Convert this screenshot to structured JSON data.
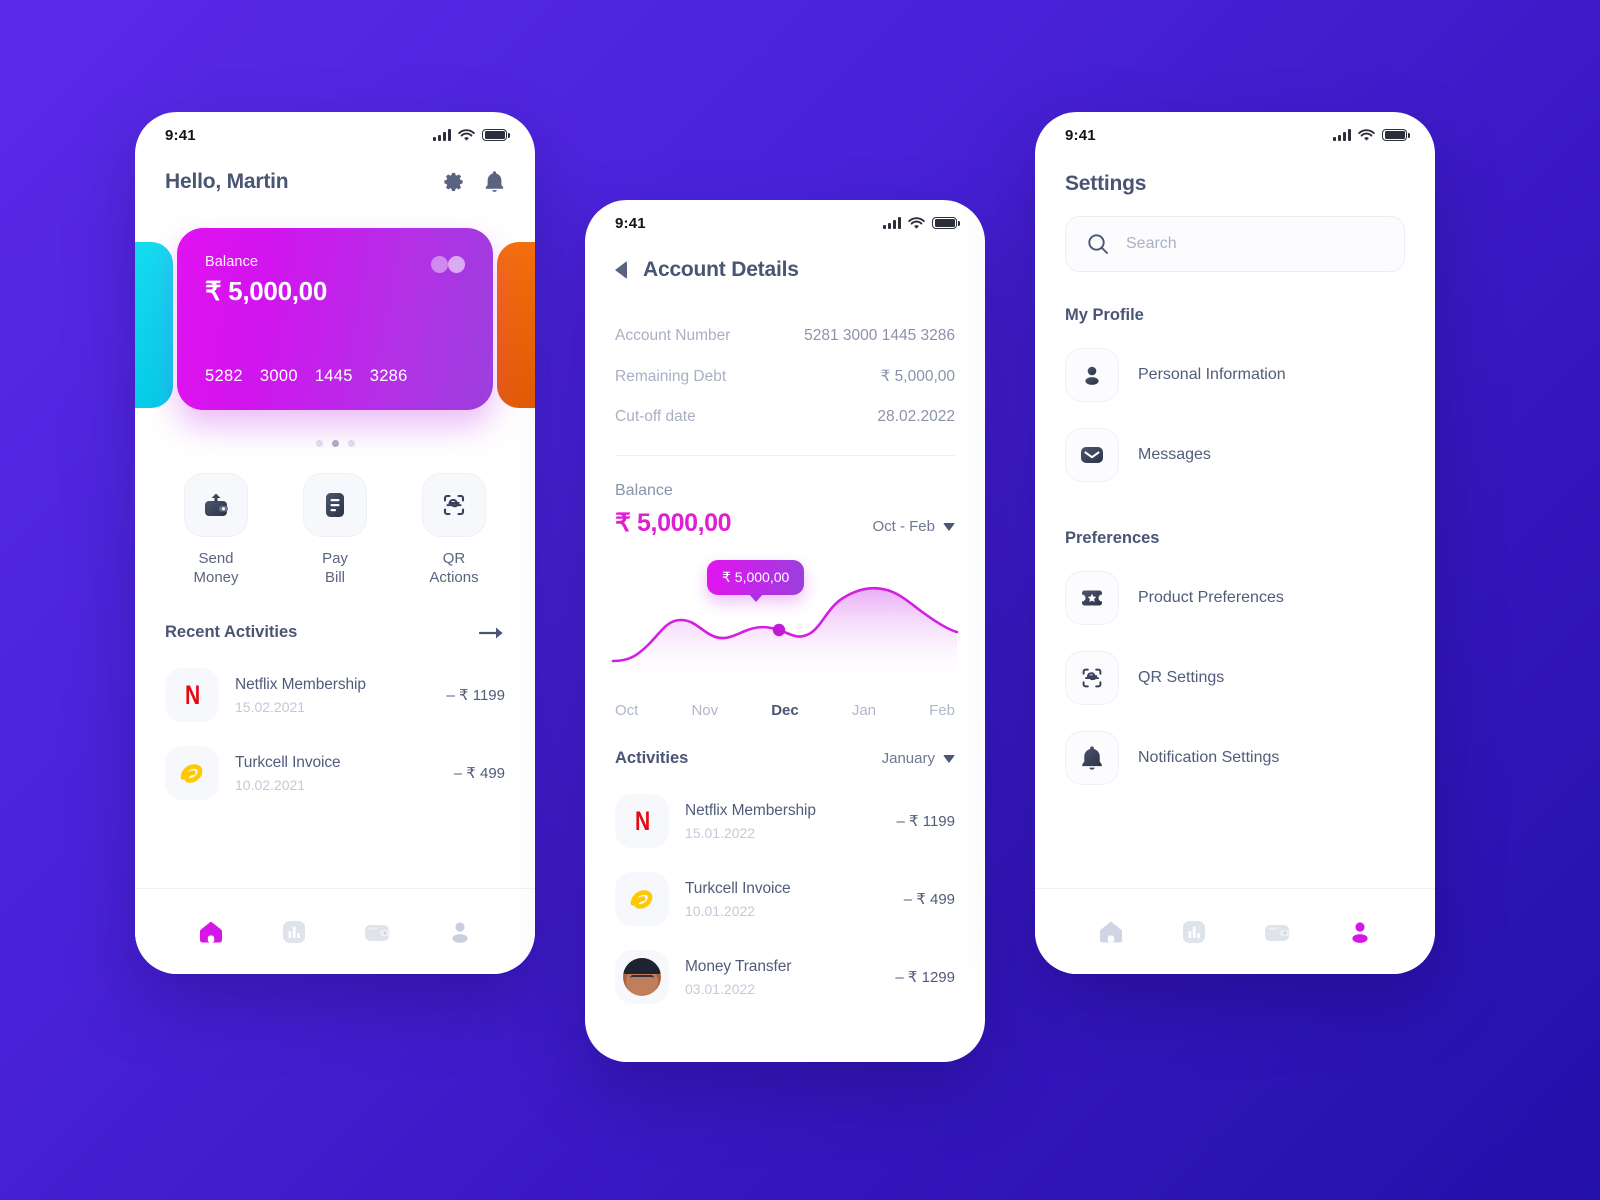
{
  "theme": {
    "bg_gradient_from": "#5a2ae8",
    "bg_gradient_to": "#2410aa",
    "accent_magenta": "#e020d0",
    "card_gradient_from": "#e112f0",
    "card_gradient_to": "#9b3fdd",
    "side_card_cyan": "#16dcf0",
    "side_card_orange": "#f5700f",
    "text_slate": "#4a5573"
  },
  "status_bar": {
    "time": "9:41"
  },
  "home": {
    "greeting": "Hello, Martin",
    "icons": {
      "settings": "gear-icon",
      "notifications": "bell-icon"
    },
    "card": {
      "label": "Balance",
      "amount": "₹ 5,000,00",
      "number_groups": [
        "5282",
        "3000",
        "1445",
        "3286"
      ]
    },
    "carousel": {
      "dots": 3,
      "active_index": 1
    },
    "quick_actions": [
      {
        "label": "Send\nMoney",
        "line1": "Send",
        "line2": "Money",
        "icon": "wallet-upload-icon"
      },
      {
        "label": "Pay Bill",
        "line1": "Pay",
        "line2": "Bill",
        "icon": "document-icon"
      },
      {
        "label": "QR Actions",
        "line1": "QR",
        "line2": "Actions",
        "icon": "qr-scan-icon"
      }
    ],
    "recent": {
      "title": "Recent Activities",
      "see_all_icon": "arrow-right-icon",
      "items": [
        {
          "name": "Netflix Membership",
          "date": "15.02.2021",
          "amount": "– ₹ 1199",
          "icon": "netflix-logo"
        },
        {
          "name": "Turkcell Invoice",
          "date": "10.02.2021",
          "amount": "– ₹ 499",
          "icon": "turkcell-logo"
        }
      ]
    },
    "nav": {
      "active": "home",
      "items": [
        "home-icon",
        "chart-icon",
        "wallet-icon",
        "person-icon"
      ]
    }
  },
  "account": {
    "title": "Account Details",
    "back_icon": "back-arrow-icon",
    "details": [
      {
        "key": "Account Number",
        "value": "5281 3000  1445 3286"
      },
      {
        "key": "Remaining Debt",
        "value": "₹ 5,000,00"
      },
      {
        "key": "Cut-off date",
        "value": "28.02.2022"
      }
    ],
    "balance": {
      "label": "Balance",
      "amount": "₹ 5,000,00",
      "range": "Oct - Feb",
      "tooltip": "₹ 5,000,00"
    },
    "activities": {
      "title": "Activities",
      "month_filter": "January",
      "items": [
        {
          "name": "Netflix Membership",
          "date": "15.01.2022",
          "amount": "– ₹ 1199",
          "icon": "netflix-logo"
        },
        {
          "name": "Turkcell Invoice",
          "date": "10.01.2022",
          "amount": "– ₹ 499",
          "icon": "turkcell-logo"
        },
        {
          "name": "Money Transfer",
          "date": "03.01.2022",
          "amount": "– ₹ 1299",
          "icon": "avatar-photo"
        }
      ]
    }
  },
  "settings": {
    "title": "Settings",
    "search": {
      "placeholder": "Search",
      "value": "",
      "icon": "search-icon"
    },
    "groups": [
      {
        "title": "My Profile",
        "items": [
          {
            "label": "Personal Information",
            "icon": "person-icon"
          },
          {
            "label": "Messages",
            "icon": "envelope-icon"
          }
        ]
      },
      {
        "title": "Preferences",
        "items": [
          {
            "label": "Product Preferences",
            "icon": "ticket-star-icon"
          },
          {
            "label": "QR Settings",
            "icon": "qr-scan-icon"
          },
          {
            "label": "Notification Settings",
            "icon": "bell-icon"
          }
        ]
      }
    ],
    "nav": {
      "active": "profile",
      "items": [
        "home-icon",
        "chart-icon",
        "wallet-icon",
        "person-icon"
      ]
    }
  },
  "chart_data": {
    "type": "area",
    "title": "Balance",
    "categories": [
      "Oct",
      "Nov",
      "Dec",
      "Jan",
      "Feb"
    ],
    "values": [
      1200,
      3200,
      3500,
      6400,
      5600
    ],
    "highlight_category": "Dec",
    "highlight_label": "₹ 5,000,00",
    "xlabel": "",
    "ylabel": "",
    "grid": false,
    "legend": "none",
    "line_color": "#d120e0",
    "fill_from": "#e8a8f5",
    "fill_to": "#ffffff"
  }
}
